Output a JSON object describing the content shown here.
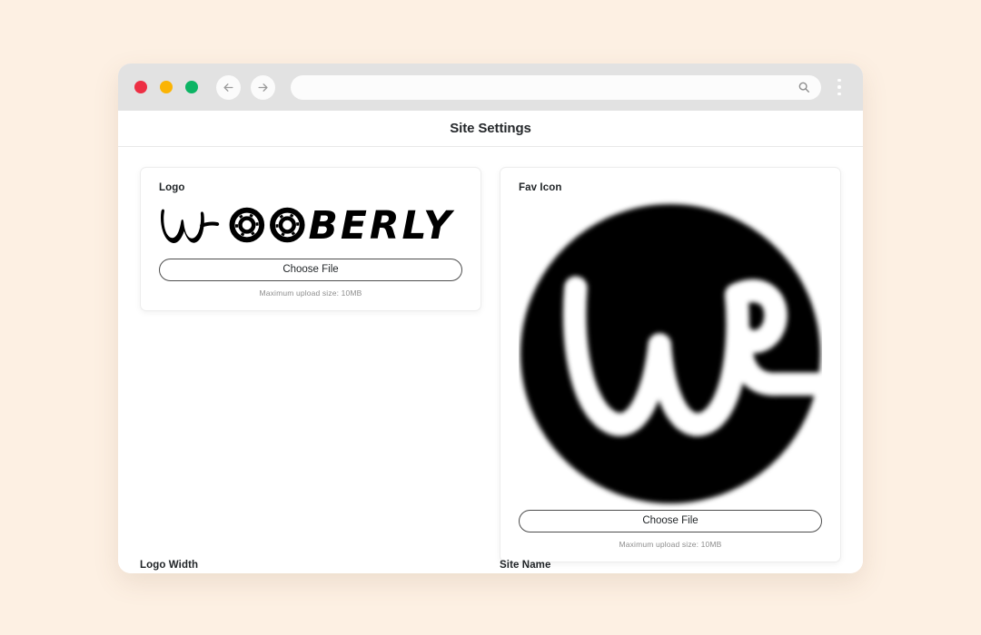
{
  "browser": {
    "traffic_lights": [
      {
        "name": "close",
        "color": "#ED2F44"
      },
      {
        "name": "minimize",
        "color": "#FBB404"
      },
      {
        "name": "maximize",
        "color": "#0CB464"
      }
    ],
    "back_icon": "arrow-left-icon",
    "forward_icon": "arrow-right-icon",
    "url_value": "",
    "url_placeholder": "",
    "search_icon": "search-icon",
    "menu_icon": "kebab-menu-icon"
  },
  "header": {
    "title": "Site Settings"
  },
  "cards": {
    "logo": {
      "label": "Logo",
      "preview_alt": "WOOBERLY",
      "wordmark_text": "WOOBERLY",
      "choose_file_label": "Choose File",
      "upload_hint": "Maximum upload size: 10MB"
    },
    "favicon": {
      "label": "Fav Icon",
      "preview_alt": "Wooberly favicon",
      "choose_file_label": "Choose File",
      "upload_hint": "Maximum upload size: 10MB"
    }
  },
  "clipped_fields": {
    "left_label": "Logo Width",
    "right_label": "Site Name"
  },
  "colors": {
    "page_background": "#FDF0E3",
    "chrome": "#E2E2E2",
    "card_background": "#FFFFFF",
    "text_primary": "#1F2326",
    "text_muted": "#8D8D8D",
    "logo_black": "#000000"
  }
}
